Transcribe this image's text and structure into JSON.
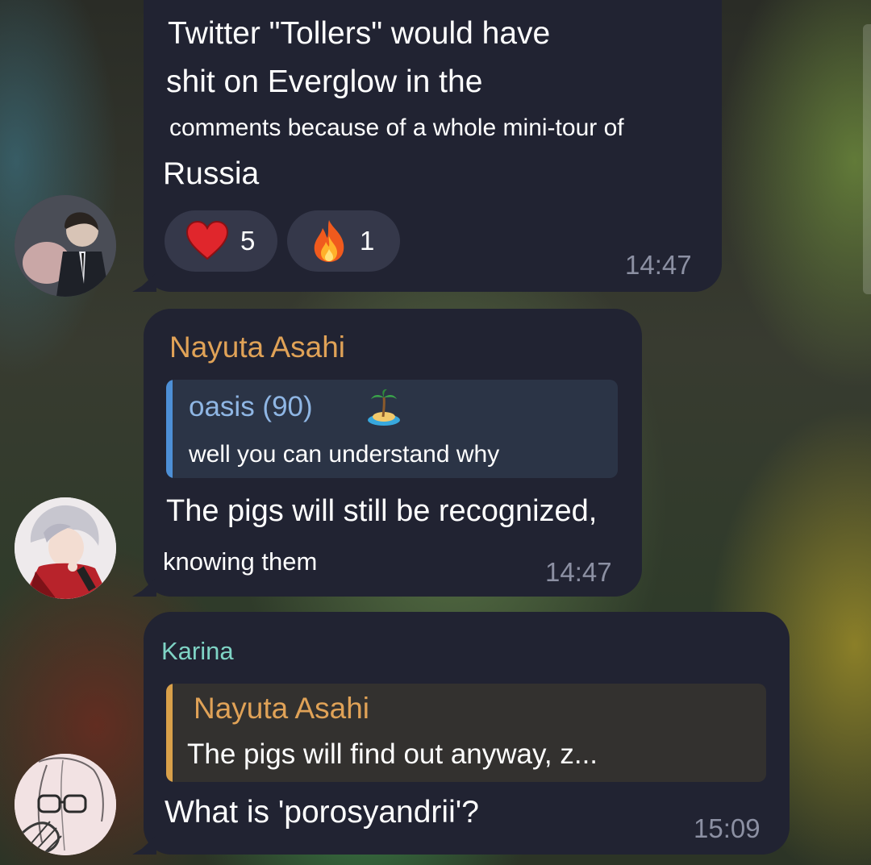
{
  "messages": [
    {
      "lines": [
        "Twitter \"Tollers\" would have",
        "shit on Everglow in the",
        "comments because of a whole mini-tour of",
        "Russia"
      ],
      "reactions": [
        {
          "emoji": "heart-icon",
          "count": "5"
        },
        {
          "emoji": "fire-icon",
          "count": "1"
        }
      ],
      "time": "14:47"
    },
    {
      "sender": "Nayuta Asahi",
      "reply": {
        "author": "oasis (90)",
        "emoji_name": "desert-island-icon",
        "text": "well you can understand why"
      },
      "lines": [
        "The pigs will still be recognized,",
        "knowing them"
      ],
      "time": "14:47"
    },
    {
      "sender": "Karina",
      "reply": {
        "author": "Nayuta Asahi",
        "text": "The pigs will find out anyway, z..."
      },
      "lines": [
        "What is 'porosyandrii'?"
      ],
      "time": "15:09"
    }
  ],
  "colors": {
    "bubble": "#212332",
    "sender_nayuta": "#e0a257",
    "sender_karina": "#7fd4c5",
    "reply_blue_bar": "#4d8fd6",
    "reply_blue_author": "#8fb6e4",
    "reply_gold_bar": "#d9a04a",
    "reply_gold_author": "#e0a257",
    "time": "#8c90a3"
  }
}
